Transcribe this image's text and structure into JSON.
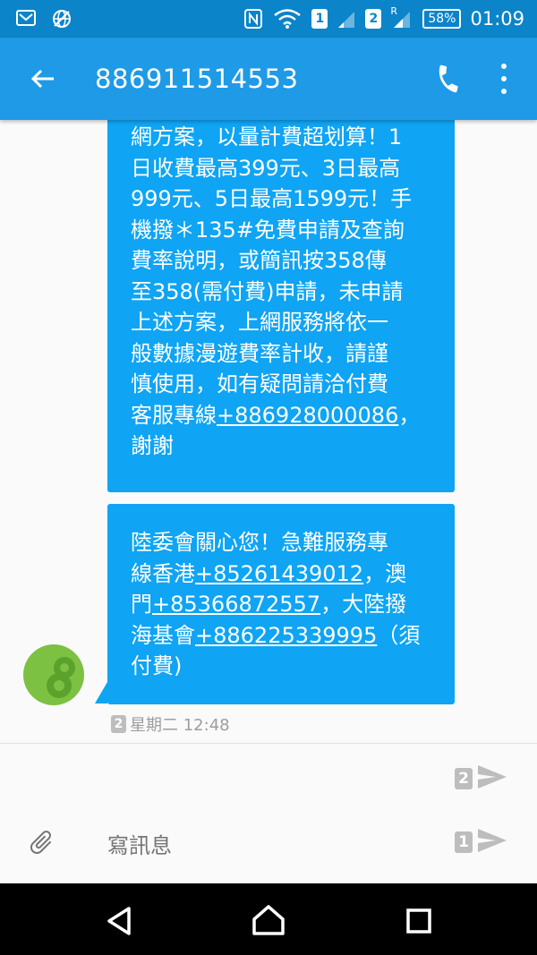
{
  "status_bar": {
    "sim1_label": "1",
    "sim2_label": "2",
    "roaming_label": "R",
    "battery": "58%",
    "time": "01:09"
  },
  "app_bar": {
    "title": "886911514553"
  },
  "messages": [
    {
      "lines": [
        "網方案，以量計費超划算！1",
        "日收費最高399元、3日最高",
        "999元、5日最高1599元！手",
        "機撥＊135#免費申請及查詢",
        "費率說明，或簡訊按358傳",
        "至358(需付費)申請，未申請",
        "上述方案，上網服務將依一",
        "般數據漫遊費率計收，請謹",
        "慎使用，如有疑問請洽付費"
      ],
      "last_line_prefix": "客服專線",
      "last_line_link": "+886928000086",
      "last_line_suffix": "，",
      "final_line": "謝謝"
    },
    {
      "line1": "陸委會關心您！急難服務專",
      "line2_prefix": "線香港",
      "line2_link": "+85261439012",
      "line2_suffix": "，澳",
      "line3_prefix": "門",
      "line3_link": "+85366872557",
      "line3_suffix": "，大陸撥",
      "line4_prefix": "海基會",
      "line4_link": "+886225339995",
      "line4_suffix": "（須",
      "line5": "付費)"
    }
  ],
  "message_meta": {
    "sim_label": "2",
    "timestamp": "星期二 12:48"
  },
  "composer": {
    "placeholder": "寫訊息",
    "send_sim2_label": "2",
    "send_sim1_label": "1"
  },
  "colors": {
    "status_bar": "#0b84c9",
    "app_bar": "#1e9ae6",
    "bubble": "#0fa4f4",
    "avatar": "#7cc142"
  },
  "icons": {
    "back": "arrow-left-icon",
    "call": "phone-icon",
    "more": "more-vert-icon",
    "attach": "paperclip-icon",
    "send": "send-icon"
  }
}
